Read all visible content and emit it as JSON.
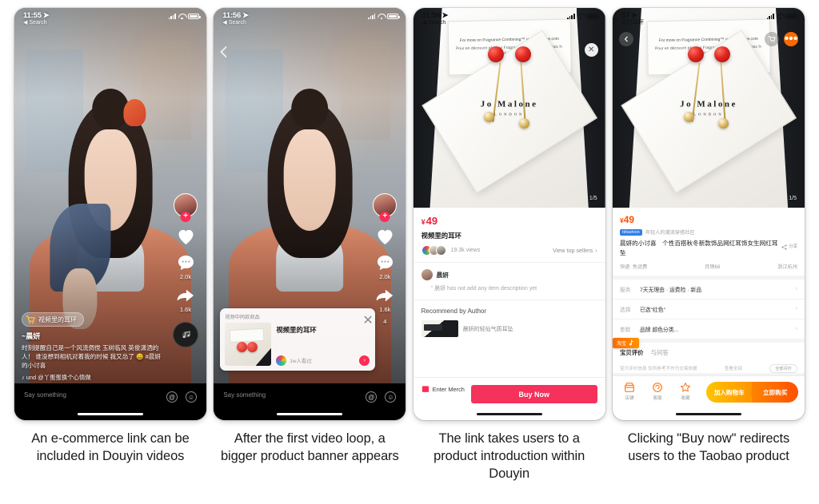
{
  "panels": [
    {
      "caption": "An e-commerce link can be included in Douyin videos",
      "status": {
        "time": "11:55",
        "back": "Search"
      },
      "rail": {
        "like": "",
        "comment": "2.0k",
        "share": "1.6k"
      },
      "overlay": {
        "cart_label": "视频里的耳环",
        "username": "~晨妍",
        "description": "时刻提醒自己是一个风流倜傥 玉树临风 英俊潇洒的人！ 谁没想到相机对着我的时候 我又怂了 😄 #晨妍的小讨喜",
        "music": "♪ und      @丫蛋蛋换个心情做"
      },
      "comment_bar": {
        "placeholder": "Say something",
        "at_icon": "@",
        "emoji_icon": "☺"
      }
    },
    {
      "caption": "After the first video loop, a bigger product banner appears",
      "status": {
        "time": "11:56",
        "back": "Search"
      },
      "rail": {
        "like": "",
        "comment": "2.0k",
        "share": "1.6k",
        "extra": "4"
      },
      "banner": {
        "header": "视频中同款商品",
        "title": "视频里的耳环",
        "shop": "1w人看过",
        "close_icon": "✕",
        "go_icon": "›"
      },
      "comment_bar": {
        "placeholder": "Say something",
        "at_icon": "@",
        "emoji_icon": "☺"
      }
    },
    {
      "caption": "The link takes users to a product introduction within Douyin",
      "status": {
        "time": "11:56",
        "back": "Search"
      },
      "photo": {
        "note_line1": "For more on Fragrance Combining™ visit jomalone.com",
        "note_line2": "Pour en découvrir plus sur Fragrance Combining™ visitez fr-jomalone.com",
        "brand_line1": "Jo Malone",
        "brand_line2": "LONDON",
        "pager": "1/5",
        "close_icon": "✕"
      },
      "detail": {
        "currency": "¥",
        "price": "49",
        "title": "视频里的耳环",
        "views": "19.3k views",
        "top_sellers": "View top sellers",
        "chevron": "›",
        "author": "晨妍",
        "no_description": "\" 晨妍 has not add any item description yet",
        "recommend_header": "Recommend by Author",
        "recommend_item": "晨妍的轻仙气质耳坠",
        "enter_merch": "Enter Merch",
        "buy_now": "Buy Now"
      }
    },
    {
      "caption": "Clicking \"Buy now\" redirects users to the Taobao product",
      "status": {
        "time": "57",
        "back": "耳钉耳环"
      },
      "topbar": {
        "back_icon": "‹",
        "cart_icon": "cart",
        "more_icon": "•••"
      },
      "photo": {
        "note_line1": "For more on Fragrance Combining™ visit jomalone.com",
        "note_line2": "Pour en découvrir plus sur Fragrance Combining™ visitez fr-jomalone.com",
        "brand_line1": "Jo Malone",
        "brand_line2": "LONDON",
        "pager": "1/5"
      },
      "taobao": {
        "currency": "¥",
        "price": "49",
        "badge": "tkfashion",
        "slogan": "年轻人的潮流穿搭社区",
        "title": "晨妍的小讨喜　个性百搭秋冬新款饰品网红耳饰女生网红耳坠",
        "share_label": "分享",
        "shipping": "快递: 免运费",
        "monthly_sales": "月销68",
        "location": "浙江杭州",
        "rows": [
          {
            "key": "服务",
            "value": "7天无理由 · 运费险 · 新品"
          },
          {
            "key": "选择",
            "value": "已选\"红色\""
          },
          {
            "key": "参数",
            "value": "品牌 颜色分类..."
          }
        ],
        "ribbon": "淘宝",
        "tabs": [
          "宝贝评价",
          "与问答"
        ],
        "note_left": "宝贝评价信息 仅供参考不作为交易依据",
        "note_right": "查看全部",
        "note_pill": "全部评价",
        "actions": [
          {
            "icon": "store-icon",
            "label": "店铺"
          },
          {
            "icon": "headset-icon",
            "label": "客服"
          },
          {
            "icon": "star-icon",
            "label": "收藏"
          }
        ],
        "add_to_cart": "加入购物车",
        "buy_now": "立即购买"
      }
    }
  ]
}
